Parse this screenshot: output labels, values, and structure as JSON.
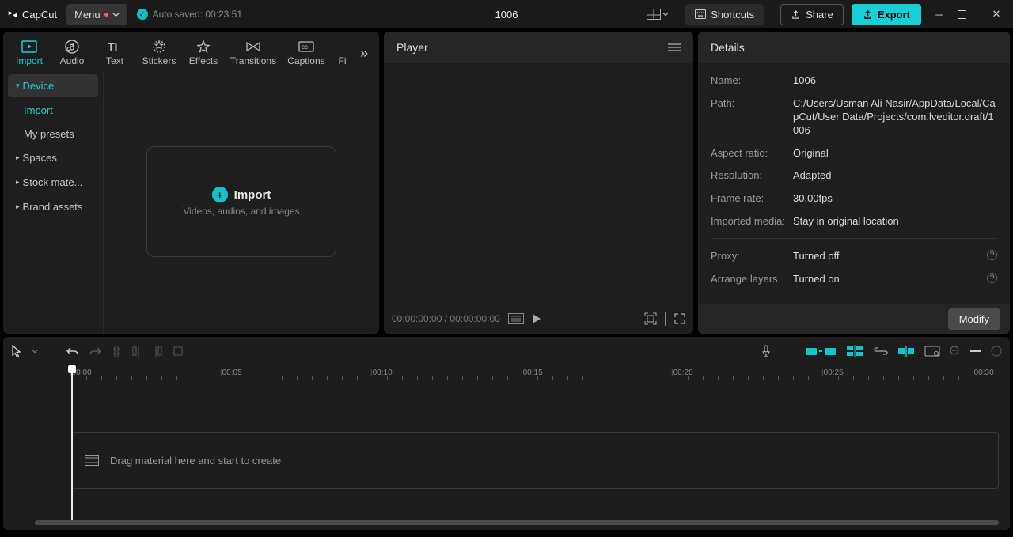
{
  "app": {
    "name": "CapCut"
  },
  "menu": {
    "label": "Menu"
  },
  "autosave": {
    "text": "Auto saved: 00:23:51"
  },
  "project": {
    "title": "1006"
  },
  "toolbar": {
    "shortcuts": "Shortcuts",
    "share": "Share",
    "export": "Export"
  },
  "mediaTabs": {
    "items": [
      {
        "label": "Import"
      },
      {
        "label": "Audio"
      },
      {
        "label": "Text"
      },
      {
        "label": "Stickers"
      },
      {
        "label": "Effects"
      },
      {
        "label": "Transitions"
      },
      {
        "label": "Captions"
      },
      {
        "label": "Fi"
      }
    ]
  },
  "mediaSide": {
    "device": "Device",
    "import": "Import",
    "presets": "My presets",
    "spaces": "Spaces",
    "stock": "Stock mate...",
    "brand": "Brand assets"
  },
  "importCard": {
    "title": "Import",
    "subtitle": "Videos, audios, and images"
  },
  "player": {
    "title": "Player",
    "time": "00:00:00:00 / 00:00:00:00"
  },
  "details": {
    "title": "Details",
    "labels": {
      "name": "Name:",
      "path": "Path:",
      "aspect": "Aspect ratio:",
      "resolution": "Resolution:",
      "framerate": "Frame rate:",
      "imported": "Imported media:",
      "proxy": "Proxy:",
      "arrange": "Arrange layers"
    },
    "values": {
      "name": "1006",
      "path": "C:/Users/Usman Ali Nasir/AppData/Local/CapCut/User Data/Projects/com.lveditor.draft/1006",
      "aspect": "Original",
      "resolution": "Adapted",
      "framerate": "30.00fps",
      "imported": "Stay in original location",
      "proxy": "Turned off",
      "arrange": "Turned on"
    },
    "modify": "Modify"
  },
  "timeline": {
    "marks": [
      "00:00",
      "00:05",
      "00:10",
      "00:15",
      "00:20",
      "00:25",
      "00:30"
    ],
    "drop": "Drag material here and start to create"
  }
}
